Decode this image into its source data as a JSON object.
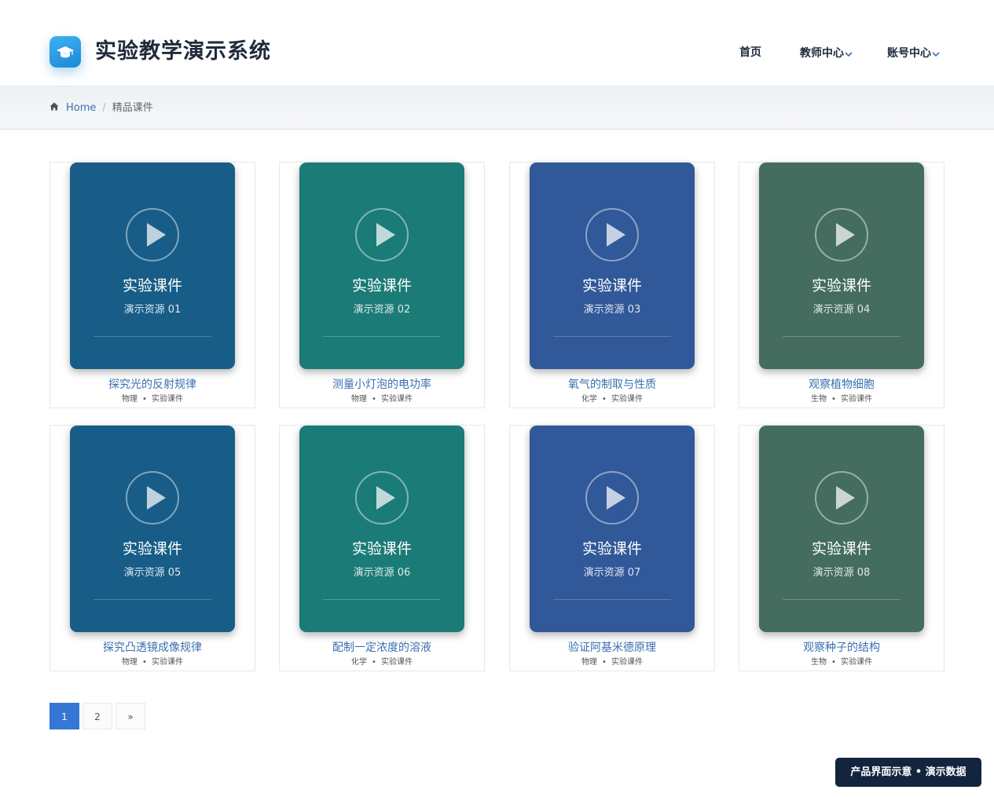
{
  "header": {
    "brand": "实验教学演示系统",
    "nav": [
      {
        "label": "首页",
        "dropdown": false
      },
      {
        "label": "教师中心",
        "dropdown": true
      },
      {
        "label": "账号中心",
        "dropdown": true
      }
    ]
  },
  "breadcrumb": {
    "home_label": "Home",
    "separator": "/",
    "current": "精品课件"
  },
  "cards": [
    {
      "cover_title": "实验课件",
      "cover_sub": "演示资源 01",
      "title": "探究光的反射规律",
      "subject": "物理",
      "type": "实验课件",
      "color": "#175d87"
    },
    {
      "cover_title": "实验课件",
      "cover_sub": "演示资源 02",
      "title": "测量小灯泡的电功率",
      "subject": "物理",
      "type": "实验课件",
      "color": "#1b7b77"
    },
    {
      "cover_title": "实验课件",
      "cover_sub": "演示资源 03",
      "title": "氧气的制取与性质",
      "subject": "化学",
      "type": "实验课件",
      "color": "#315898"
    },
    {
      "cover_title": "实验课件",
      "cover_sub": "演示资源 04",
      "title": "观察植物细胞",
      "subject": "生物",
      "type": "实验课件",
      "color": "#446d5f"
    },
    {
      "cover_title": "实验课件",
      "cover_sub": "演示资源 05",
      "title": "探究凸透镜成像规律",
      "subject": "物理",
      "type": "实验课件",
      "color": "#175d87"
    },
    {
      "cover_title": "实验课件",
      "cover_sub": "演示资源 06",
      "title": "配制一定浓度的溶液",
      "subject": "化学",
      "type": "实验课件",
      "color": "#1b7b77"
    },
    {
      "cover_title": "实验课件",
      "cover_sub": "演示资源 07",
      "title": "验证阿基米德原理",
      "subject": "物理",
      "type": "实验课件",
      "color": "#315898"
    },
    {
      "cover_title": "实验课件",
      "cover_sub": "演示资源 08",
      "title": "观察种子的结构",
      "subject": "生物",
      "type": "实验课件",
      "color": "#446d5f"
    }
  ],
  "meta_separator": "•",
  "pagination": {
    "pages": [
      "1",
      "2"
    ],
    "current": "1",
    "next_label": "»"
  },
  "badge": "产品界面示意 • 演示数据",
  "icons": {
    "logo": "graduation-cap-icon",
    "home": "home-icon",
    "cover": "play-icon",
    "dropdown": "chevron-down-icon"
  }
}
